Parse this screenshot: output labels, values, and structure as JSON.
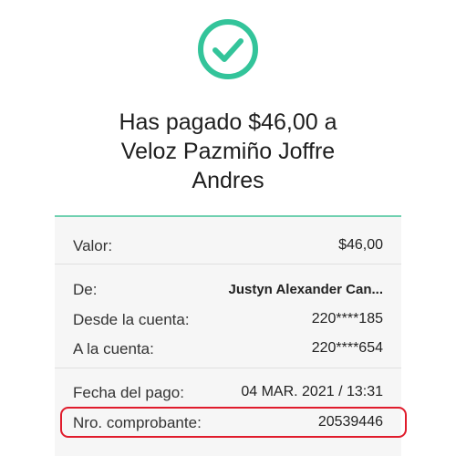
{
  "colors": {
    "success_green": "#33c49a",
    "card_accent": "#6fd0b0",
    "highlight_red": "#e01c2c"
  },
  "icons": {
    "status": "check-circle-icon"
  },
  "header": {
    "message": "Has pagado $46,00 a\nVeloz  Pazmiño Joffre\nAndres"
  },
  "details": {
    "amount": {
      "label": "Valor:",
      "value": "$46,00"
    },
    "from": {
      "label": "De:",
      "value": "Justyn Alexander Can..."
    },
    "from_account": {
      "label": "Desde la cuenta:",
      "value": "220****185"
    },
    "to_account": {
      "label": "A la cuenta:",
      "value": "220****654"
    },
    "payment_date": {
      "label": "Fecha del pago:",
      "value": "04 MAR. 2021 / 13:31"
    },
    "receipt_number": {
      "label": "Nro. comprobante:",
      "value": "20539446"
    }
  }
}
